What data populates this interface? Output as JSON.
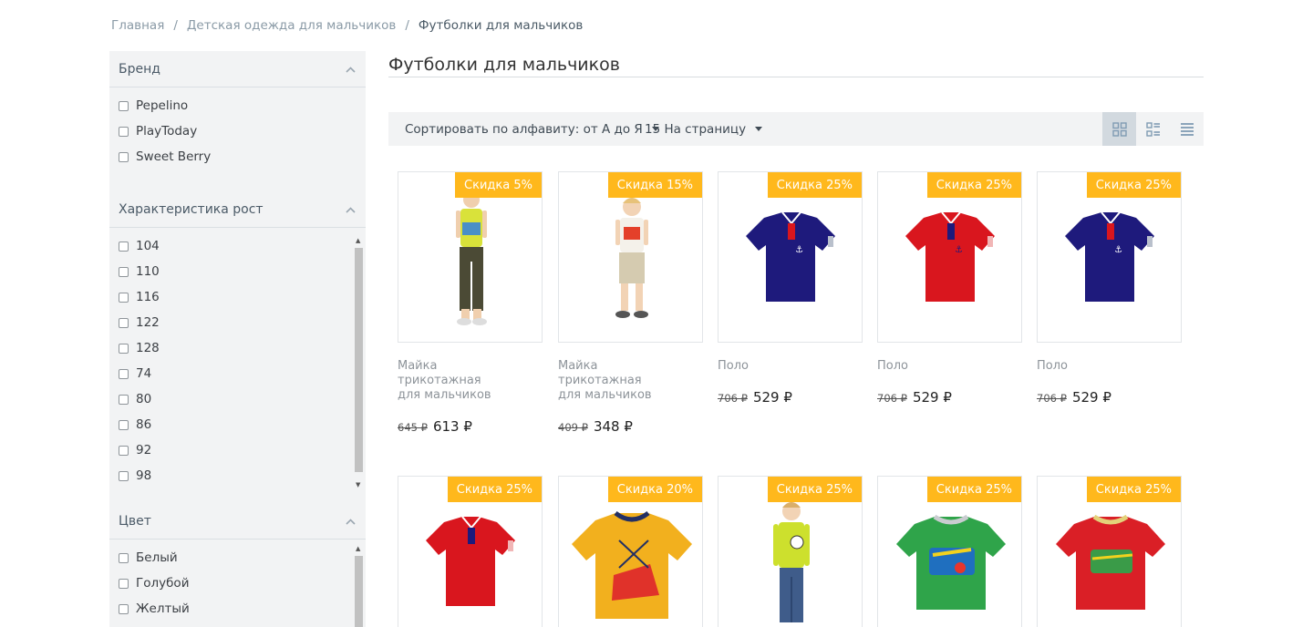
{
  "breadcrumb": {
    "items": [
      "Главная",
      "Детская одежда для мальчиков"
    ],
    "separator": "/",
    "current": "Футболки для мальчиков"
  },
  "filters": {
    "brand": {
      "title": "Бренд",
      "options": [
        "Pepelino",
        "PlayToday",
        "Sweet Berry"
      ]
    },
    "height": {
      "title": "Характеристика рост",
      "options": [
        "104",
        "110",
        "116",
        "122",
        "128",
        "74",
        "80",
        "86",
        "92",
        "98"
      ]
    },
    "color": {
      "title": "Цвет",
      "options": [
        "Белый",
        "Голубой",
        "Желтый"
      ]
    }
  },
  "page": {
    "title": "Футболки для мальчиков"
  },
  "toolbar": {
    "sort_label": "Сортировать по алфавиту: от А до Я",
    "per_page_label": "15 На страницу"
  },
  "products": [
    {
      "badge": "Скидка 5%",
      "name": "Майка трикотажная для мальчиков",
      "old_price": "645 ₽",
      "price": "613 ₽",
      "image": "boy-sleeveless-yellow-icon"
    },
    {
      "badge": "Скидка 15%",
      "name": "Майка трикотажная для мальчиков",
      "old_price": "409 ₽",
      "price": "348 ₽",
      "image": "boy-tanktop-white-icon"
    },
    {
      "badge": "Скидка 25%",
      "name": "Поло",
      "old_price": "706 ₽",
      "price": "529 ₽",
      "image": "polo-navy-icon"
    },
    {
      "badge": "Скидка 25%",
      "name": "Поло",
      "old_price": "706 ₽",
      "price": "529 ₽",
      "image": "polo-red-icon"
    },
    {
      "badge": "Скидка 25%",
      "name": "Поло",
      "old_price": "706 ₽",
      "price": "529 ₽",
      "image": "polo-navy-icon"
    },
    {
      "badge": "Скидка 25%",
      "image": "polo-red-icon"
    },
    {
      "badge": "Скидка 20%",
      "image": "tshirt-yellow-sneaker-icon"
    },
    {
      "badge": "Скидка 25%",
      "image": "boy-longsleeve-lime-icon"
    },
    {
      "badge": "Скидка 25%",
      "image": "tshirt-green-icon"
    },
    {
      "badge": "Скидка 25%",
      "image": "tshirt-red-icon"
    }
  ],
  "colors": {
    "badge": "#ffb81c",
    "sidebar_bg": "#f2f3f4",
    "navy": "#1e1a7c",
    "red": "#d9161e"
  }
}
